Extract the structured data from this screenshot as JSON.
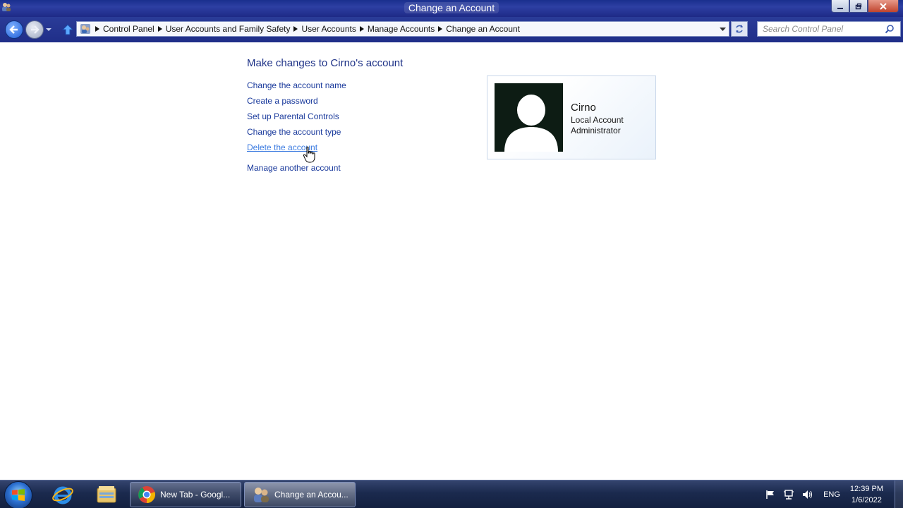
{
  "window": {
    "title": "Change an Account",
    "buttons": {
      "minimize": "minimize",
      "maximize": "maximize",
      "close": "close"
    }
  },
  "navigation": {
    "breadcrumbs": [
      "Control Panel",
      "User Accounts and Family Safety",
      "User Accounts",
      "Manage Accounts",
      "Change an Account"
    ],
    "search_placeholder": "Search Control Panel"
  },
  "main": {
    "heading": "Make changes to Cirno's account",
    "tasks": [
      {
        "label": "Change the account name"
      },
      {
        "label": "Create a password"
      },
      {
        "label": "Set up Parental Controls"
      },
      {
        "label": "Change the account type"
      },
      {
        "label": "Delete the account",
        "state": "hover"
      },
      {
        "label": "Manage another account"
      }
    ],
    "account": {
      "name": "Cirno",
      "type": "Local Account",
      "role": "Administrator"
    }
  },
  "taskbar": {
    "pinned": [
      "internet-explorer-icon",
      "windows-explorer-icon"
    ],
    "items": [
      {
        "label": "New Tab - Googl...",
        "icon": "chrome-icon",
        "active": false
      },
      {
        "label": "Change an Accou...",
        "icon": "user-accounts-icon",
        "active": true
      }
    ],
    "tray": {
      "language": "ENG",
      "time": "12:39 PM",
      "date": "1/6/2022"
    }
  },
  "colors": {
    "link": "#1a3a9c",
    "link_hover": "#3a7ae0",
    "heading": "#1e3287",
    "titlebar": "#1f2e88",
    "taskbar": "#1b2a4e"
  }
}
